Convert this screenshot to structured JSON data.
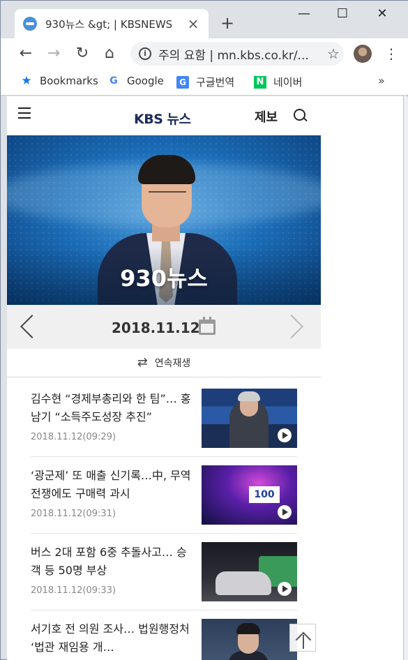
{
  "browser": {
    "tab_title": "930뉴스 &gt; | KBSNEWS",
    "tab_close": "×",
    "new_tab": "+",
    "window_controls": {
      "minimize": "—",
      "maximize": "☐",
      "close": "✕"
    },
    "nav": {
      "back": "←",
      "forward": "→",
      "reload": "↻",
      "home": "⌂"
    },
    "address": "주의 요함 | mn.kbs.co.kr/...",
    "info_icon": "i",
    "star": "☆",
    "menu": "⋮",
    "bookmarks": [
      {
        "label": "Bookmarks",
        "icon": "★",
        "icon_color": "#1a73e8"
      },
      {
        "label": "Google",
        "icon": "G",
        "icon_color": "#4285f4"
      },
      {
        "label": "구글번역",
        "icon": "G",
        "icon_color": "#4285f4"
      },
      {
        "label": "네이버",
        "icon": "N",
        "icon_color": "#03c75a"
      }
    ],
    "bookmarks_more": "»"
  },
  "site": {
    "logo": "KBS 뉴스",
    "report_label": "제보"
  },
  "hero": {
    "title": "930뉴스"
  },
  "datebar": {
    "date": "2018.11.12"
  },
  "autoplay": {
    "icon": "⇄",
    "label": "연속재생"
  },
  "news": [
    {
      "title": "김수현 “경제부총리와 한 팀”… 홍남기 “소득주도성장 추진”",
      "time": "2018.11.12(09:29)"
    },
    {
      "title": "‘광군제’ 또 매출 신기록…中, 무역전쟁에도 구매력 과시",
      "time": "2018.11.12(09:31)",
      "thumb_text": "100"
    },
    {
      "title": "버스 2대 포함 6중 추돌사고… 승객 등 50명 부상",
      "time": "2018.11.12(09:33)"
    },
    {
      "title": "서기호 전 의원 조사… 법원행정처 ‘법관 재임용 개…",
      "time": ""
    }
  ],
  "colors": {
    "kbs_navy": "#1b2a5b",
    "chrome_frame": "#dee1e6"
  }
}
